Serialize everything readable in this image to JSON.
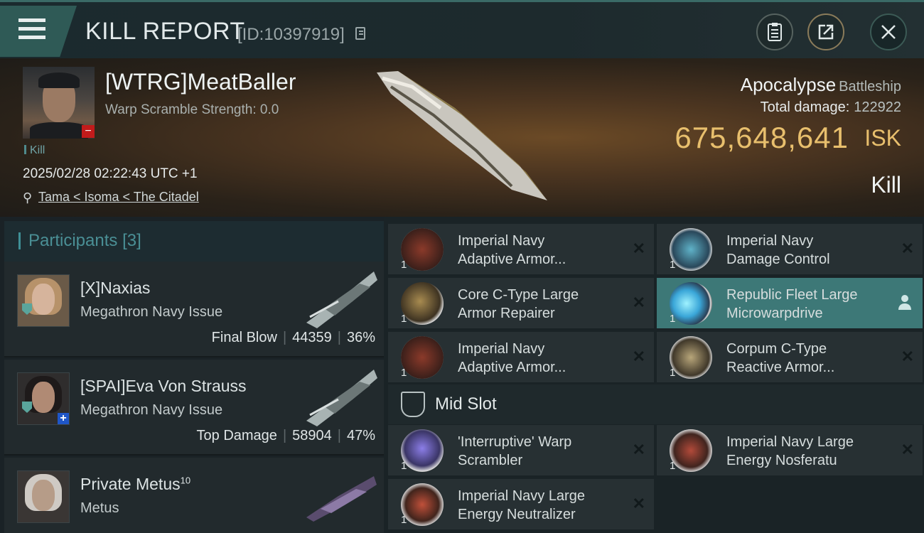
{
  "header": {
    "title": "KILL REPORT",
    "report_id": "[ID:10397919]",
    "icons": [
      "menu-icon",
      "copy-icon",
      "clipboard-icon",
      "share-icon",
      "close-icon"
    ]
  },
  "victim": {
    "name": "[WTRG]MeatBaller",
    "warp_scramble": "Warp Scramble Strength: 0.0",
    "kill_tag": "Kill",
    "timestamp": "2025/02/28 02:22:43 UTC +1",
    "location": "Tama < Isoma < The Citadel",
    "ship_name": "Apocalypse",
    "ship_class": "Battleship",
    "total_damage_label": "Total damage:",
    "total_damage_value": "122922",
    "isk_value": "675,648,641",
    "isk_unit": "ISK",
    "status": "Kill"
  },
  "participants": {
    "title": "Participants",
    "count": "[3]",
    "items": [
      {
        "name": "[X]Naxias",
        "ship": "Megathron Navy Issue",
        "role": "Final Blow",
        "damage": "44359",
        "percent": "36%"
      },
      {
        "name": "[SPAI]Eva Von Strauss",
        "ship": "Megathron Navy Issue",
        "role": "Top Damage",
        "damage": "58904",
        "percent": "47%"
      },
      {
        "name": "Private Metus",
        "superscript": "10",
        "ship": "Metus"
      }
    ]
  },
  "modules": {
    "low_slots": [
      {
        "qty": "1",
        "line1": "Imperial Navy",
        "line2": "Adaptive Armor..."
      },
      {
        "qty": "1",
        "line1": "Imperial Navy",
        "line2": "Damage Control"
      },
      {
        "qty": "1",
        "line1": "Core C-Type Large",
        "line2": "Armor Repairer"
      },
      {
        "qty": "1",
        "line1": "Republic Fleet Large",
        "line2": "Microwarpdrive"
      },
      {
        "qty": "1",
        "line1": "Imperial Navy",
        "line2": "Adaptive Armor..."
      },
      {
        "qty": "1",
        "line1": "Corpum C-Type",
        "line2": "Reactive Armor..."
      }
    ],
    "mid_slot_title": "Mid Slot",
    "mid_slots": [
      {
        "qty": "1",
        "line1": "'Interruptive' Warp",
        "line2": "Scrambler"
      },
      {
        "qty": "1",
        "line1": "Imperial Navy Large",
        "line2": "Energy Nosferatu"
      },
      {
        "qty": "1",
        "line1": "Imperial Navy Large",
        "line2": "Energy Neutralizer"
      }
    ]
  },
  "colors": {
    "accent_teal": "#3f8f96",
    "isk_gold": "#e8bf6d",
    "highlight_row": "#3d7877",
    "badge_red": "#c21b1b",
    "badge_blue": "#1f56c7"
  }
}
